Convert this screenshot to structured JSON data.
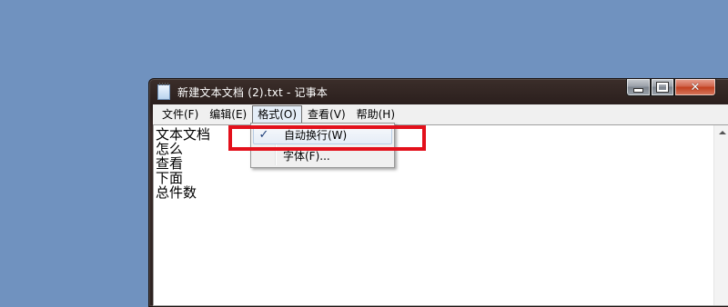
{
  "window": {
    "title": "新建文本文档 (2).txt - 记事本",
    "icon": "notepad-icon"
  },
  "titlebar_buttons": {
    "minimize": "minimize-icon",
    "maximize": "maximize-icon",
    "close": "close-icon"
  },
  "menubar": {
    "items": [
      {
        "label": "文件(F)"
      },
      {
        "label": "编辑(E)"
      },
      {
        "label": "格式(O)",
        "active": true
      },
      {
        "label": "查看(V)"
      },
      {
        "label": "帮助(H)"
      }
    ]
  },
  "format_menu": {
    "items": [
      {
        "label": "自动换行(W)",
        "checked": true,
        "check_mark": "✓"
      },
      {
        "label": "字体(F)...",
        "checked": false
      }
    ]
  },
  "document": {
    "lines": [
      "文本文档",
      "怎么",
      "查看",
      "下面",
      "总件数"
    ]
  },
  "colors": {
    "desktop": "#7092bf",
    "annotation_box": "#e3101b"
  }
}
